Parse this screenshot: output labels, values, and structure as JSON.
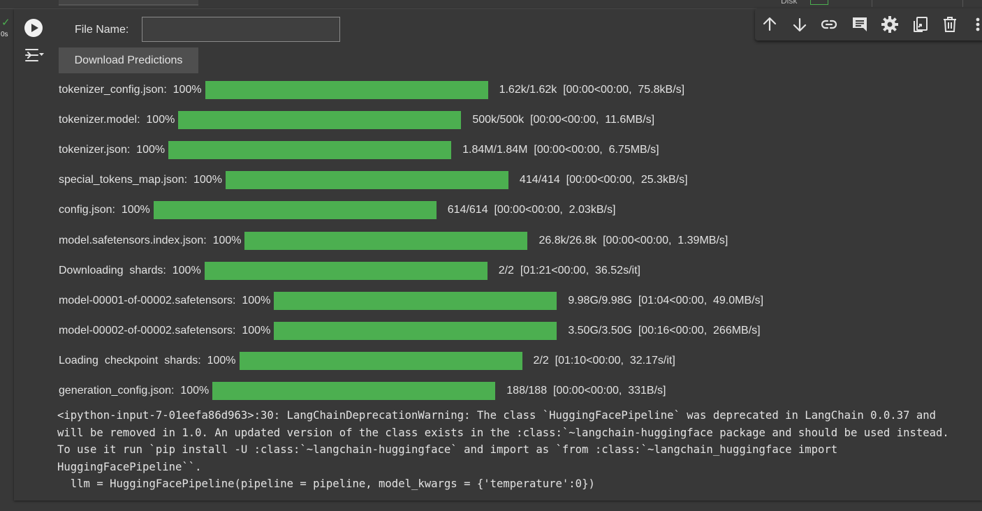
{
  "cell": {
    "status_icon": "check-icon",
    "exec_time": "0s",
    "run_icon": "play-icon",
    "output_icon": "output-toggle-icon"
  },
  "topbar": {
    "disk_label": "Disk"
  },
  "toolbar": {
    "icons": [
      "arrow-up-icon",
      "arrow-down-icon",
      "link-icon",
      "comment-icon",
      "gear-icon",
      "mirror-cell-icon",
      "trash-icon",
      "more-vertical-icon"
    ]
  },
  "form": {
    "filename_label": "File Name:",
    "filename_value": "",
    "download_label": "Download Predictions"
  },
  "progress": [
    {
      "label": "tokenizer_config.json:  100%",
      "progress": 1.0,
      "stats": "1.62k/1.62k  [00:00<00:00,  75.8kB/s]"
    },
    {
      "label": "tokenizer.model:  100%",
      "progress": 1.0,
      "stats": "500k/500k  [00:00<00:00,  11.6MB/s]"
    },
    {
      "label": "tokenizer.json:  100%",
      "progress": 1.0,
      "stats": "1.84M/1.84M  [00:00<00:00,  6.75MB/s]"
    },
    {
      "label": "special_tokens_map.json:  100%",
      "progress": 1.0,
      "stats": "414/414  [00:00<00:00,  25.3kB/s]"
    },
    {
      "label": "config.json:  100%",
      "progress": 1.0,
      "stats": "614/614  [00:00<00:00,  2.03kB/s]"
    },
    {
      "label": "model.safetensors.index.json:  100%",
      "progress": 1.0,
      "stats": "26.8k/26.8k  [00:00<00:00,  1.39MB/s]"
    },
    {
      "label": "Downloading  shards:  100%",
      "progress": 1.0,
      "stats": "2/2  [01:21<00:00,  36.52s/it]"
    },
    {
      "label": "model-00001-of-00002.safetensors:  100%",
      "progress": 1.0,
      "stats": "9.98G/9.98G  [01:04<00:00,  49.0MB/s]"
    },
    {
      "label": "model-00002-of-00002.safetensors:  100%",
      "progress": 1.0,
      "stats": "3.50G/3.50G  [00:16<00:00,  266MB/s]"
    },
    {
      "label": "Loading  checkpoint  shards:  100%",
      "progress": 1.0,
      "stats": "2/2  [01:10<00:00,  32.17s/it]"
    },
    {
      "label": "generation_config.json:  100%",
      "progress": 1.0,
      "stats": "188/188  [00:00<00:00,  331B/s]"
    }
  ],
  "stderr": {
    "text": "<ipython-input-7-01eefa86d963>:30: LangChainDeprecationWarning: The class `HuggingFacePipeline` was deprecated in LangChain 0.0.37 and will be removed in 1.0. An updated version of the class exists in the :class:`~langchain-huggingface package and should be used instead. To use it run `pip install -U :class:`~langchain-huggingface` and import as `from :class:`~langchain_huggingface import HuggingFacePipeline``.\n  llm = HuggingFacePipeline(pipeline = pipeline, model_kwargs = {'temperature':0})"
  },
  "colors": {
    "progress_fill": "#4caf50",
    "background": "#383838",
    "text": "#e3e3e3"
  }
}
